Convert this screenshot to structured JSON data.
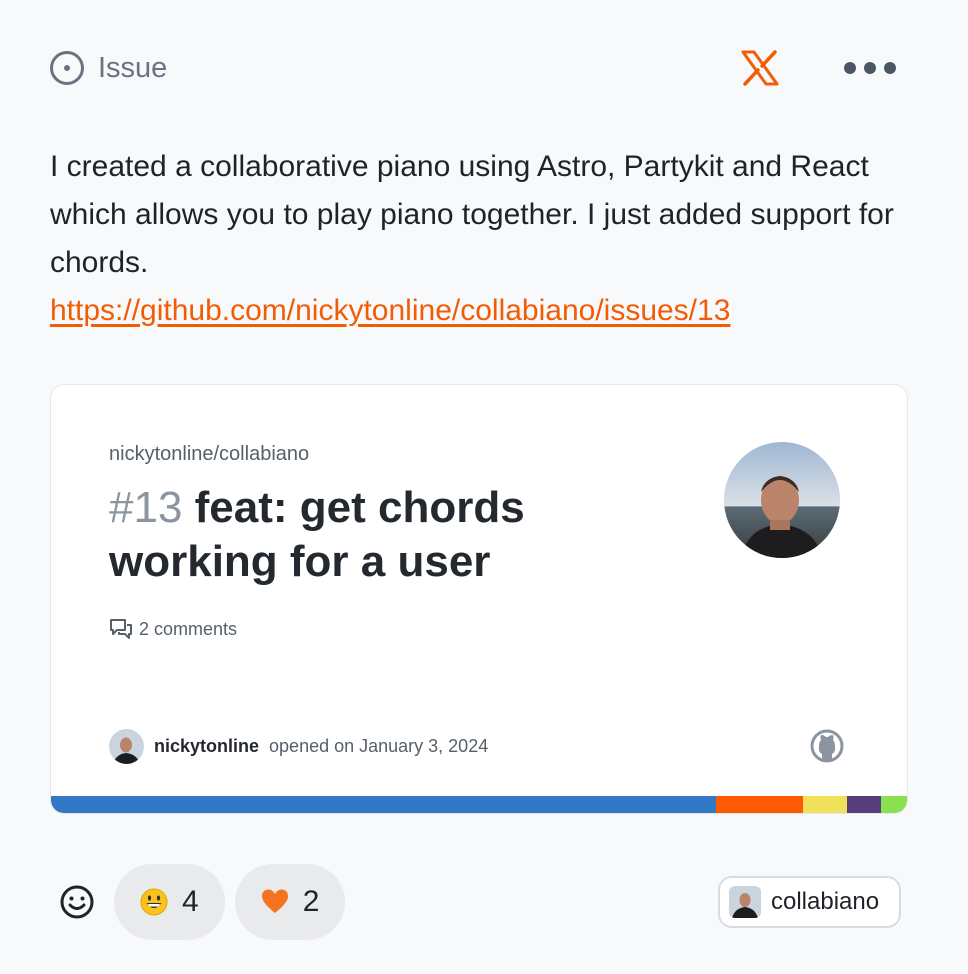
{
  "header": {
    "type_label": "Issue",
    "icons": {
      "type": "issue-opened-icon",
      "social": "x-logo-icon",
      "menu": "more-horizontal-icon"
    },
    "accent": "#f25c05"
  },
  "post": {
    "text": "I created a collaborative piano using Astro, Partykit and React which allows you to play piano together. I just added support for chords.",
    "link": "https://github.com/nickytonline/collabiano/issues/13"
  },
  "card": {
    "repo": "nickytonline/collabiano",
    "issue_number": "#13",
    "title": "feat: get chords working for a user",
    "comments": "2 comments",
    "author": "nickytonline",
    "opened": "opened on January 3, 2024",
    "language_colors": [
      "#3178c6",
      "#ff5a03",
      "#f1e05a",
      "#563d7c",
      "#89e051"
    ],
    "language_shares": [
      0.777,
      0.102,
      0.051,
      0.04,
      0.03
    ]
  },
  "reactions": [
    {
      "emoji": "grinning-face-icon",
      "count": "4"
    },
    {
      "emoji": "orange-heart-icon",
      "count": "2"
    }
  ],
  "repo_chip": {
    "label": "collabiano"
  }
}
